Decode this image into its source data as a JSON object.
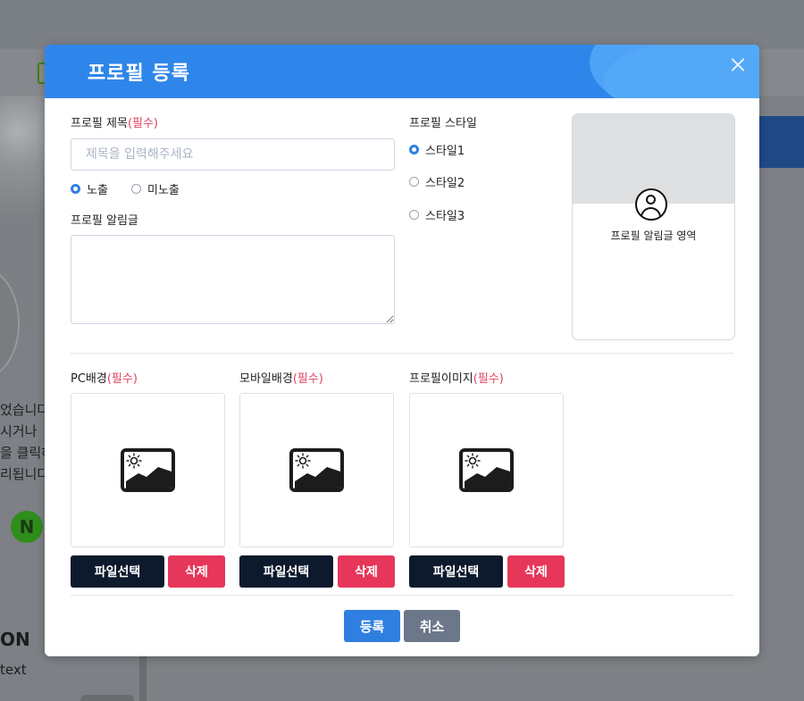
{
  "background": {
    "lines": [
      "었습니다",
      "시거나",
      "을 클릭하",
      "리됩니다"
    ],
    "logo_letter": "N",
    "bold_text": "ON",
    "small_text": "text"
  },
  "modal": {
    "title": "프로필 등록",
    "title_field": {
      "label": "프로필 제목",
      "required": "(필수)",
      "placeholder": "제목을 입력해주세요",
      "value": ""
    },
    "visibility": {
      "options": [
        "노출",
        "미노출"
      ],
      "selected": "노출"
    },
    "notice_field": {
      "label": "프로필 알림글",
      "value": ""
    },
    "style": {
      "label": "프로필 스타일",
      "options": [
        "스타일1",
        "스타일2",
        "스타일3"
      ],
      "selected": "스타일1"
    },
    "preview": {
      "text": "프로필 알림글 영역"
    },
    "uploads": [
      {
        "label": "PC배경",
        "required": "(필수)",
        "select_label": "파일선택",
        "delete_label": "삭제"
      },
      {
        "label": "모바일배경",
        "required": "(필수)",
        "select_label": "파일선택",
        "delete_label": "삭제"
      },
      {
        "label": "프로필이미지",
        "required": "(필수)",
        "select_label": "파일선택",
        "delete_label": "삭제"
      }
    ],
    "footer": {
      "submit_label": "등록",
      "cancel_label": "취소"
    }
  },
  "colors": {
    "header": "#2f86ea",
    "required": "#e0435f",
    "primary": "#2f7fe0",
    "dark_button": "#0d1a2e",
    "danger": "#e6375a",
    "secondary": "#6c7889"
  },
  "icons": [
    "close-icon",
    "user-avatar-icon",
    "image-icon",
    "sun-icon",
    "mountain-icon"
  ]
}
